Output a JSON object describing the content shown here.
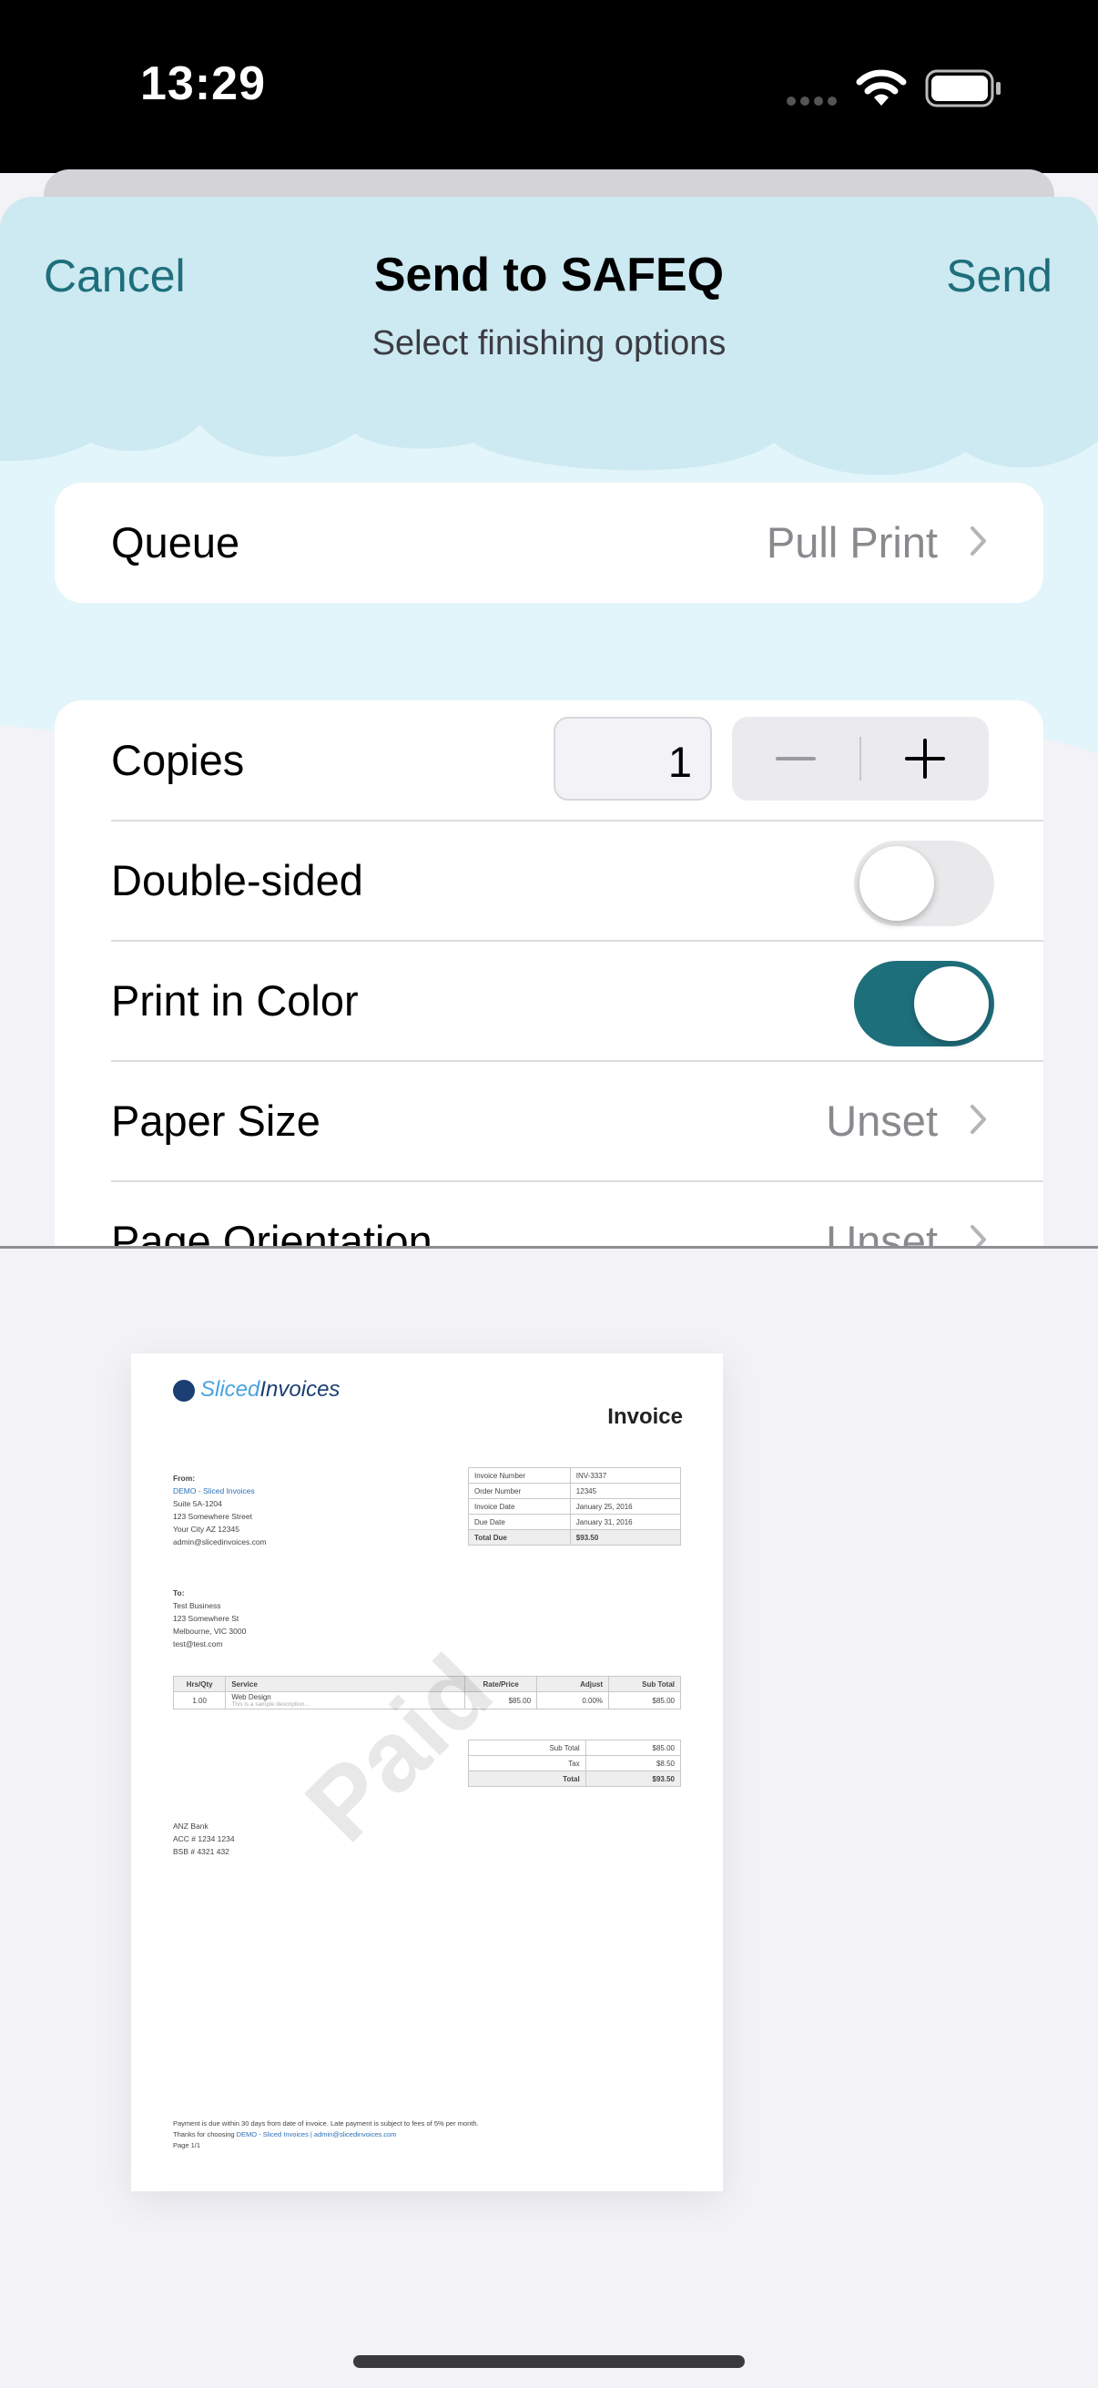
{
  "status_bar": {
    "time": "13:29",
    "icons": [
      "signal-dots-icon",
      "wifi-icon",
      "battery-icon"
    ]
  },
  "nav": {
    "cancel": "Cancel",
    "title": "Send to SAFEQ",
    "subtitle": "Select finishing options",
    "send": "Send"
  },
  "queue": {
    "label": "Queue",
    "value": "Pull Print"
  },
  "options": {
    "copies_label": "Copies",
    "copies_value": "1",
    "stepper_minus": "−",
    "stepper_plus": "+",
    "double_sided_label": "Double-sided",
    "double_sided_on": false,
    "print_in_color_label": "Print in Color",
    "print_in_color_on": true,
    "paper_size_label": "Paper Size",
    "paper_size_value": "Unset",
    "page_orientation_label": "Page Orientation",
    "page_orientation_value": "Unset"
  },
  "preview": {
    "logo_a": "Sliced",
    "logo_b": "Invoices",
    "invoice_title": "Invoice",
    "from": [
      "From:",
      "DEMO - Sliced Invoices",
      "Suite 5A-1204",
      "123 Somewhere Street",
      "Your City AZ 12345",
      "admin@slicedinvoices.com"
    ],
    "to": [
      "To:",
      "Test Business",
      "123 Somewhere St",
      "Melbourne, VIC 3000",
      "test@test.com"
    ],
    "meta_rows": [
      [
        "Invoice Number",
        "INV-3337"
      ],
      [
        "Order Number",
        "12345"
      ],
      [
        "Invoice Date",
        "January 25, 2016"
      ],
      [
        "Due Date",
        "January 31, 2016"
      ],
      [
        "Total Due",
        "$93.50"
      ]
    ],
    "items_header": [
      "Hrs/Qty",
      "Service",
      "Rate/Price",
      "Adjust",
      "Sub Total"
    ],
    "item_row": [
      "1.00",
      "Web Design",
      "$85.00",
      "0.00%",
      "$85.00"
    ],
    "item_desc": "This is a sample description...",
    "totals_rows": [
      [
        "Sub Total",
        "$85.00"
      ],
      [
        "Tax",
        "$8.50"
      ],
      [
        "Total",
        "$93.50"
      ]
    ],
    "bank": [
      "ANZ Bank",
      "ACC # 1234 1234",
      "BSB # 4321 432"
    ],
    "footer_line1": "Payment is due within 30 days from date of invoice. Late payment is subject to fees of 5% per month.",
    "footer_line2_prefix": "Thanks for choosing ",
    "footer_line2_link": "DEMO - Sliced Invoices | admin@slicedinvoices.com",
    "footer_page": "Page 1/1",
    "watermark": "Paid"
  }
}
